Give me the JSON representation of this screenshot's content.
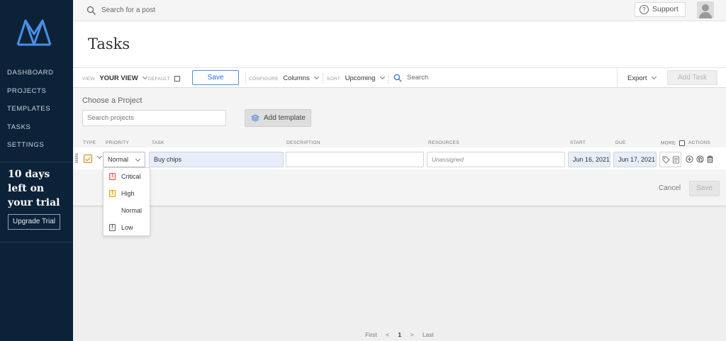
{
  "sidebar": {
    "logo": "logo-m-icon",
    "nav": [
      "DASHBOARD",
      "PROJECTS",
      "TEMPLATES",
      "TASKS",
      "SETTINGS"
    ],
    "trial_text": "10 days left on your trial",
    "upgrade_label": "Upgrade Trial"
  },
  "topbar": {
    "search_placeholder": "Search for a post",
    "support_label": "Support"
  },
  "page": {
    "title": "Tasks"
  },
  "toolbar": {
    "view_label": "VIEW",
    "view_value": "YOUR VIEW",
    "default_label": "DEFAULT",
    "save_label": "Save",
    "configure_label": "CONFIGURE",
    "configure_value": "Columns",
    "sort_label": "SORT",
    "sort_value": "Upcoming",
    "search_label": "Search",
    "export_label": "Export",
    "add_task_label": "Add Task"
  },
  "project": {
    "choose_label": "Choose a Project",
    "search_placeholder": "Search projects",
    "add_template_label": "Add template"
  },
  "columns": {
    "type": "TYPE",
    "priority": "PRIORITY",
    "task": "TASK",
    "description": "DESCRIPTION",
    "resources": "RESOURCES",
    "start": "START",
    "due": "DUE",
    "more": "MORE",
    "actions": "ACTIONS"
  },
  "task_row": {
    "priority": "Normal",
    "task": "Buy chips",
    "description": "",
    "resources": "Unassigned",
    "start": "Jun 16, 2021",
    "due": "Jun 17, 2021"
  },
  "form_actions": {
    "cancel": "Cancel",
    "save": "Save"
  },
  "priority_options": [
    {
      "label": "Critical",
      "color": "#d9534f"
    },
    {
      "label": "High",
      "color": "#e0a100"
    },
    {
      "label": "Normal",
      "color": ""
    },
    {
      "label": "Low",
      "color": "#666666"
    }
  ],
  "pagination": {
    "first": "First",
    "prev": "<",
    "current": "1",
    "next": ">",
    "last": "Last"
  },
  "colors": {
    "sidebar_bg": "#0c2238",
    "accent": "#4a90e2"
  }
}
